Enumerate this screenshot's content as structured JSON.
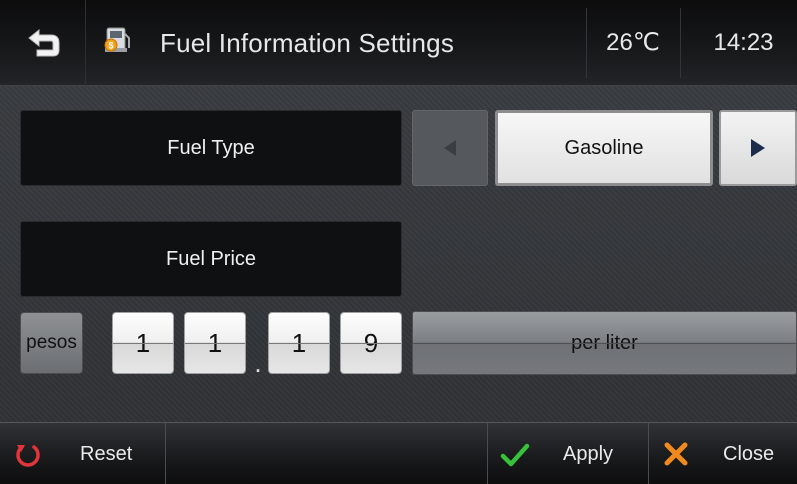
{
  "header": {
    "title": "Fuel Information Settings",
    "temperature": "26℃",
    "time": "14:23"
  },
  "fuel_type": {
    "label": "Fuel Type",
    "value": "Gasoline"
  },
  "fuel_price": {
    "label": "Fuel Price",
    "currency": "pesos",
    "digits": [
      "1",
      "1",
      "1",
      "9"
    ],
    "decimal_point": ".",
    "unit": "per liter"
  },
  "footer": {
    "reset_label": "Reset",
    "apply_label": "Apply",
    "close_label": "Close"
  },
  "colors": {
    "apply_check": "#38c23a",
    "close_x": "#f08a1c",
    "reset_icon": "#e2353a"
  },
  "icons": {
    "back": "back-arrow-icon",
    "app": "fuel-pump-icon",
    "prev": "triangle-left-icon",
    "next": "triangle-right-icon",
    "reset": "refresh-icon",
    "apply": "checkmark-icon",
    "close": "close-icon"
  }
}
